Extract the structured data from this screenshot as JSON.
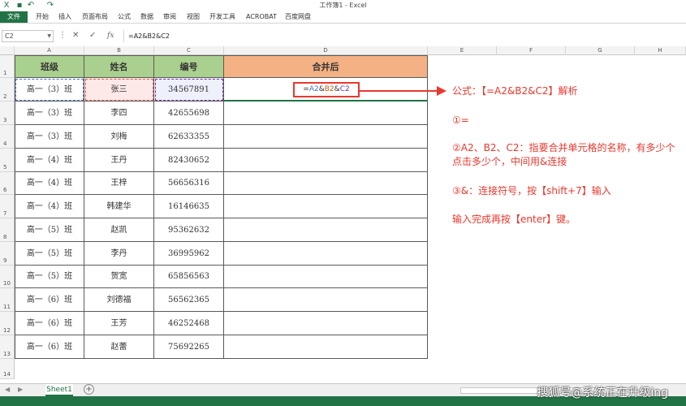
{
  "window": {
    "title": "工作簿1 - Excel"
  },
  "ribbon": {
    "tabs": [
      "文件",
      "开始",
      "插入",
      "页面布局",
      "公式",
      "数据",
      "审阅",
      "视图",
      "开发工具",
      "ACROBAT",
      "百度网盘"
    ]
  },
  "formula_bar": {
    "name_box": "C2",
    "cancel": "✕",
    "enter": "✓",
    "fx": "fx",
    "formula": "=A2&B2&C2"
  },
  "columns": [
    "A",
    "B",
    "C",
    "D",
    "E",
    "F",
    "G",
    "H"
  ],
  "rows": [
    "1",
    "2",
    "3",
    "4",
    "5",
    "6",
    "7",
    "8",
    "9",
    "10",
    "11",
    "12",
    "13",
    "14"
  ],
  "table": {
    "headers": [
      "班级",
      "姓名",
      "编号",
      "合并后"
    ],
    "rows": [
      [
        "高一（3）班",
        "张三",
        "34567891"
      ],
      [
        "高一（3）班",
        "李四",
        "42655698"
      ],
      [
        "高一（3）班",
        "刘梅",
        "62633355"
      ],
      [
        "高一（4）班",
        "王丹",
        "82430652"
      ],
      [
        "高一（4）班",
        "王梓",
        "56656316"
      ],
      [
        "高一（4）班",
        "韩建华",
        "16146635"
      ],
      [
        "高一（5）班",
        "赵凯",
        "95362632"
      ],
      [
        "高一（5）班",
        "李丹",
        "36995962"
      ],
      [
        "高一（5）班",
        "贺宽",
        "65856563"
      ],
      [
        "高一（6）班",
        "刘德福",
        "56562365"
      ],
      [
        "高一（6）班",
        "王芳",
        "46252468"
      ],
      [
        "高一（6）班",
        "赵蕾",
        "75692265"
      ]
    ],
    "editing_formula": {
      "eq": "=",
      "a": "A2",
      "amp1": "&",
      "b": "B2",
      "amp2": "&",
      "c": "C2"
    }
  },
  "annotations": {
    "line1": "公式：【=A2&B2&C2】解析",
    "line2": "①=",
    "line3": "②A2、B2、C2：指要合并单元格的名称，有多少个点击多少个，中间用&连接",
    "line4": "③&：连接符号，按【shift+7】输入",
    "line5": "输入完成再按【enter】键。"
  },
  "sheets": {
    "active": "Sheet1"
  },
  "watermark": "搜狐号@系统正在升级ing",
  "colors": {
    "excel_green": "#217346",
    "header_green": "#a9d08e",
    "header_orange": "#f4b183",
    "annotation_red": "#e8382f",
    "ref_blue": "#4472c4",
    "ref_orange": "#c55a11",
    "ref_purple": "#7030a0"
  }
}
